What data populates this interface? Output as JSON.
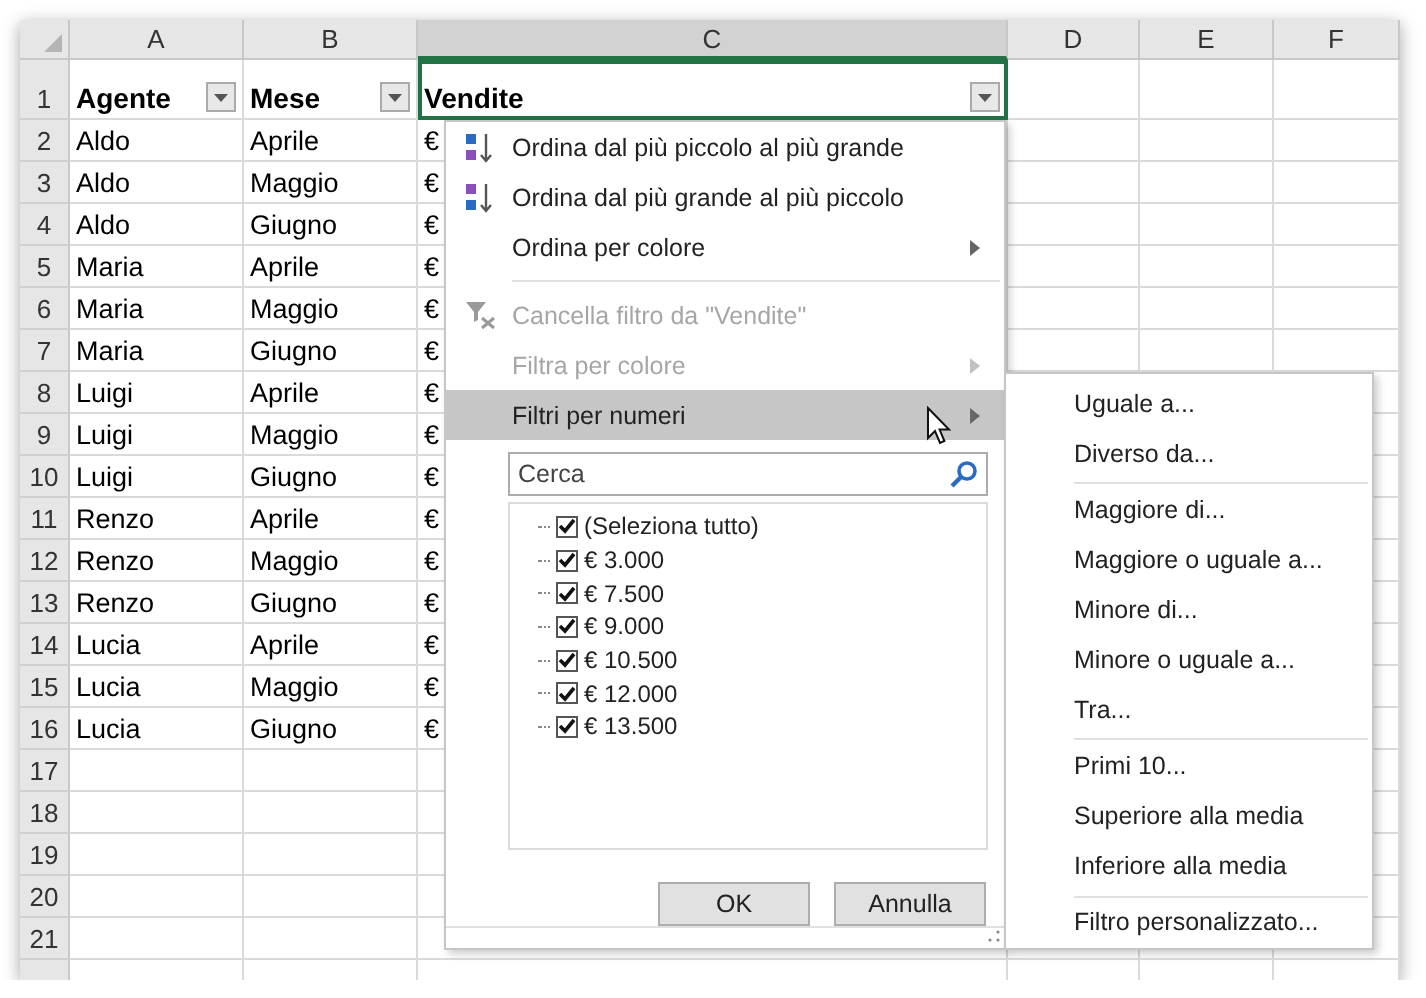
{
  "columns": [
    {
      "label": "A",
      "selected": false
    },
    {
      "label": "B",
      "selected": false
    },
    {
      "label": "C",
      "selected": true
    },
    {
      "label": "D",
      "selected": false
    },
    {
      "label": "E",
      "selected": false
    },
    {
      "label": "F",
      "selected": false
    }
  ],
  "rows": [
    {
      "number": "1",
      "kind": "header",
      "cells": [
        {
          "text": "Agente",
          "filter": true,
          "active": false
        },
        {
          "text": "Mese",
          "filter": true,
          "active": false
        },
        {
          "text": "Vendite",
          "filter": true,
          "active": true
        },
        {
          "filter": false,
          "active": false
        },
        {
          "filter": false,
          "active": false
        },
        {
          "filter": false,
          "active": false
        }
      ]
    },
    {
      "number": "2",
      "kind": "data",
      "cells": [
        {
          "text": "Aldo"
        },
        {
          "text": "Aprile"
        },
        {
          "text": "€"
        },
        {},
        {},
        {}
      ]
    },
    {
      "number": "3",
      "kind": "data",
      "cells": [
        {
          "text": "Aldo"
        },
        {
          "text": "Maggio"
        },
        {
          "text": "€"
        },
        {},
        {},
        {}
      ]
    },
    {
      "number": "4",
      "kind": "data",
      "cells": [
        {
          "text": "Aldo"
        },
        {
          "text": "Giugno"
        },
        {
          "text": "€"
        },
        {},
        {},
        {}
      ]
    },
    {
      "number": "5",
      "kind": "data",
      "cells": [
        {
          "text": "Maria"
        },
        {
          "text": "Aprile"
        },
        {
          "text": "€"
        },
        {},
        {},
        {}
      ]
    },
    {
      "number": "6",
      "kind": "data",
      "cells": [
        {
          "text": "Maria"
        },
        {
          "text": "Maggio"
        },
        {
          "text": "€"
        },
        {},
        {},
        {}
      ]
    },
    {
      "number": "7",
      "kind": "data",
      "cells": [
        {
          "text": "Maria"
        },
        {
          "text": "Giugno"
        },
        {
          "text": "€"
        },
        {},
        {},
        {}
      ]
    },
    {
      "number": "8",
      "kind": "data",
      "cells": [
        {
          "text": "Luigi"
        },
        {
          "text": "Aprile"
        },
        {
          "text": "€"
        },
        {},
        {},
        {}
      ]
    },
    {
      "number": "9",
      "kind": "data",
      "cells": [
        {
          "text": "Luigi"
        },
        {
          "text": "Maggio"
        },
        {
          "text": "€"
        },
        {},
        {},
        {}
      ]
    },
    {
      "number": "10",
      "kind": "data",
      "cells": [
        {
          "text": "Luigi"
        },
        {
          "text": "Giugno"
        },
        {
          "text": "€"
        },
        {},
        {},
        {}
      ]
    },
    {
      "number": "11",
      "kind": "data",
      "cells": [
        {
          "text": "Renzo"
        },
        {
          "text": "Aprile"
        },
        {
          "text": "€"
        },
        {},
        {},
        {}
      ]
    },
    {
      "number": "12",
      "kind": "data",
      "cells": [
        {
          "text": "Renzo"
        },
        {
          "text": "Maggio"
        },
        {
          "text": "€"
        },
        {},
        {},
        {}
      ]
    },
    {
      "number": "13",
      "kind": "data",
      "cells": [
        {
          "text": "Renzo"
        },
        {
          "text": "Giugno"
        },
        {
          "text": "€"
        },
        {},
        {},
        {}
      ]
    },
    {
      "number": "14",
      "kind": "data",
      "cells": [
        {
          "text": "Lucia"
        },
        {
          "text": "Aprile"
        },
        {
          "text": "€"
        },
        {},
        {},
        {}
      ]
    },
    {
      "number": "15",
      "kind": "data",
      "cells": [
        {
          "text": "Lucia"
        },
        {
          "text": "Maggio"
        },
        {
          "text": "€"
        },
        {},
        {},
        {}
      ]
    },
    {
      "number": "16",
      "kind": "data",
      "cells": [
        {
          "text": "Lucia"
        },
        {
          "text": "Giugno"
        },
        {
          "text": "€"
        },
        {},
        {},
        {}
      ]
    },
    {
      "number": "17",
      "kind": "data",
      "cells": [
        {},
        {},
        {},
        {},
        {},
        {}
      ]
    },
    {
      "number": "18",
      "kind": "data",
      "cells": [
        {},
        {},
        {},
        {},
        {},
        {}
      ]
    },
    {
      "number": "19",
      "kind": "data",
      "cells": [
        {},
        {},
        {},
        {},
        {},
        {}
      ]
    },
    {
      "number": "20",
      "kind": "data",
      "cells": [
        {},
        {},
        {},
        {},
        {},
        {}
      ]
    },
    {
      "number": "21",
      "kind": "data",
      "cells": [
        {},
        {},
        {},
        {},
        {},
        {}
      ]
    },
    {
      "kind": "partial",
      "cells": [
        {},
        {},
        {},
        {},
        {},
        {}
      ]
    }
  ],
  "filter_menu": {
    "items": [
      {
        "kind": "sort_ascending",
        "label": "Ordina dal più piccolo al più grande",
        "disabled": false,
        "submenu": false,
        "highlighted": false
      },
      {
        "kind": "sort_descending",
        "label": "Ordina dal più grande al più piccolo",
        "disabled": false,
        "submenu": false,
        "highlighted": false
      },
      {
        "kind": "item",
        "label": "Ordina per colore",
        "disabled": false,
        "submenu": true,
        "highlighted": false
      },
      {
        "kind": "separator"
      },
      {
        "kind": "clear_filter",
        "label": "Cancella filtro da \"Vendite\"",
        "disabled": true,
        "submenu": false,
        "highlighted": false
      },
      {
        "kind": "item",
        "label": "Filtra per colore",
        "disabled": true,
        "submenu": true,
        "highlighted": false
      },
      {
        "kind": "item",
        "label": "Filtri per numeri",
        "disabled": false,
        "submenu": true,
        "highlighted": true
      }
    ],
    "search": {
      "placeholder": "Cerca"
    },
    "values": [
      {
        "label": "(Seleziona tutto)",
        "checked": true
      },
      {
        "label": "€ 3.000",
        "checked": true
      },
      {
        "label": "€ 7.500",
        "checked": true
      },
      {
        "label": "€ 9.000",
        "checked": true
      },
      {
        "label": "€ 10.500",
        "checked": true
      },
      {
        "label": "€ 12.000",
        "checked": true
      },
      {
        "label": "€ 13.500",
        "checked": true
      }
    ],
    "buttons": [
      "OK",
      "Annulla"
    ]
  },
  "number_filters_menu": [
    {
      "kind": "item",
      "label": "Uguale a..."
    },
    {
      "kind": "item",
      "label": "Diverso da..."
    },
    {
      "kind": "separator"
    },
    {
      "kind": "item",
      "label": "Maggiore di..."
    },
    {
      "kind": "item",
      "label": "Maggiore o uguale a..."
    },
    {
      "kind": "item",
      "label": "Minore di..."
    },
    {
      "kind": "item",
      "label": "Minore o uguale a..."
    },
    {
      "kind": "item",
      "label": "Tra..."
    },
    {
      "kind": "separator"
    },
    {
      "kind": "item",
      "label": "Primi 10..."
    },
    {
      "kind": "item",
      "label": "Superiore alla media"
    },
    {
      "kind": "item",
      "label": "Inferiore alla media"
    },
    {
      "kind": "separator"
    },
    {
      "kind": "item",
      "label": "Filtro personalizzato..."
    }
  ]
}
